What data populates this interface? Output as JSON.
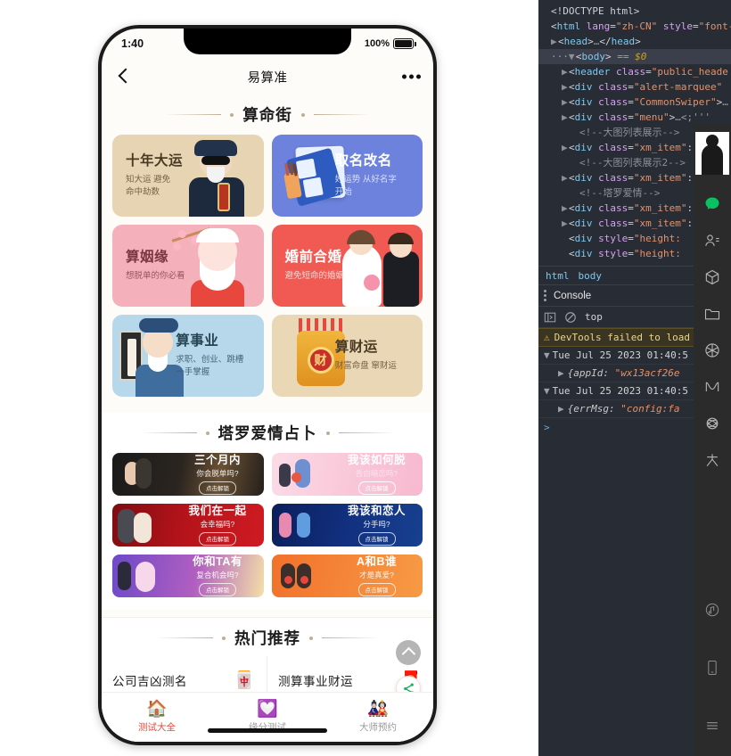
{
  "phone": {
    "status": {
      "time": "1:40",
      "battery_pct": "100%"
    },
    "nav": {
      "title": "易算准",
      "back_icon": "chevron-left-icon",
      "more_icon": "more-horizontal-icon"
    },
    "sections": [
      {
        "title": "算命街"
      },
      {
        "title": "塔罗爱情占卜"
      },
      {
        "title": "热门推荐"
      }
    ],
    "menu_cards": [
      {
        "title": "十年大运",
        "sub": "知大运 避免\n命中劫数",
        "art": "elder-icon",
        "color": "#e6d4b3"
      },
      {
        "title": "取名改名",
        "sub": "好运势 从好名字\n开始",
        "art": "naming-book-icon",
        "color": "#6c82dd"
      },
      {
        "title": "算姻缘",
        "sub": "想脱单的你必看",
        "art": "fuxing-icon",
        "color": "#f5b1bb"
      },
      {
        "title": "婚前合婚",
        "sub": "避免短命的婚姻",
        "art": "wedding-couple-icon",
        "color": "#f05a52"
      },
      {
        "title": "算事业",
        "sub": "求职、创业、跳槽\n一手掌握",
        "art": "scholar-icon",
        "color": "#b6d8ea"
      },
      {
        "title": "算财运",
        "sub": "财富命盘 窜财运",
        "art": "wealth-pot-icon",
        "color": "#e9d7b6"
      }
    ],
    "tarot_cards": [
      {
        "title": "三个月内",
        "sub": "你会脱单吗?",
        "btn": "点击解锁",
        "art": "couple-dark-icon"
      },
      {
        "title": "我该如何脱",
        "sub": "告白暗恋吗?",
        "btn": "点击解锁",
        "art": "couple-pink-icon"
      },
      {
        "title": "我们在一起",
        "sub": "会幸福吗?",
        "btn": "点击解锁",
        "art": "couple-red-icon"
      },
      {
        "title": "我该和恋人",
        "sub": "分手吗?",
        "btn": "点击解锁",
        "art": "couple-blue-icon"
      },
      {
        "title": "你和TA有",
        "sub": "复合机会吗?",
        "btn": "点击解锁",
        "art": "couple-purple-icon"
      },
      {
        "title": "A和B谁",
        "sub": "才是真爱?",
        "btn": "点击解锁",
        "art": "couple-orange-icon"
      }
    ],
    "hot_items": [
      {
        "label": "公司吉凶测名",
        "icon": "name-seal-icon"
      },
      {
        "label": "测算事业财运",
        "icon": "money-bag-icon"
      },
      {
        "label": "",
        "icon": "red-house-icon"
      },
      {
        "label": "",
        "icon": "heart-icon"
      }
    ],
    "fabs": [
      {
        "name": "scroll-to-top",
        "icon": "chevron-up-icon"
      },
      {
        "name": "share",
        "icon": "share-icon"
      }
    ],
    "tabs": [
      {
        "label": "测试大全",
        "icon": "home-icon",
        "active": true
      },
      {
        "label": "缘分测试",
        "icon": "heart-icon",
        "active": false
      },
      {
        "label": "大师预约",
        "icon": "masters-icon",
        "active": false
      }
    ]
  },
  "devtools": {
    "dom": [
      {
        "indent": 0,
        "twisty": "",
        "parts": [
          {
            "c": "punc",
            "t": "<!DOCTYPE html>"
          }
        ]
      },
      {
        "indent": 0,
        "twisty": "",
        "parts": [
          {
            "c": "punc",
            "t": "<"
          },
          {
            "c": "tag",
            "t": "html"
          },
          {
            "c": "attr",
            "t": " lang"
          },
          {
            "c": "eq",
            "t": "="
          },
          {
            "c": "val",
            "t": "\"zh-CN\""
          },
          {
            "c": "attr",
            "t": " style"
          },
          {
            "c": "eq",
            "t": "="
          },
          {
            "c": "val",
            "t": "\"font-"
          }
        ]
      },
      {
        "indent": 1,
        "twisty": "▶",
        "parts": [
          {
            "c": "punc",
            "t": "<"
          },
          {
            "c": "tag",
            "t": "head"
          },
          {
            "c": "punc",
            "t": ">"
          },
          {
            "c": "dots",
            "t": "…"
          },
          {
            "c": "punc",
            "t": "</"
          },
          {
            "c": "tag",
            "t": "head"
          },
          {
            "c": "punc",
            "t": ">"
          }
        ]
      },
      {
        "indent": 1,
        "twisty": "▼",
        "selected": true,
        "prefix": "···",
        "parts": [
          {
            "c": "punc",
            "t": "<"
          },
          {
            "c": "tag",
            "t": "body"
          },
          {
            "c": "punc",
            "t": ">"
          },
          {
            "c": "gray",
            "t": "  == "
          },
          {
            "c": "ital",
            "t": "$0"
          }
        ]
      },
      {
        "indent": 2,
        "twisty": "▶",
        "parts": [
          {
            "c": "punc",
            "t": "<"
          },
          {
            "c": "tag",
            "t": "header"
          },
          {
            "c": "attr",
            "t": " class"
          },
          {
            "c": "eq",
            "t": "="
          },
          {
            "c": "val",
            "t": "\"public_heade"
          }
        ]
      },
      {
        "indent": 2,
        "twisty": "▶",
        "parts": [
          {
            "c": "punc",
            "t": "<"
          },
          {
            "c": "tag",
            "t": "div"
          },
          {
            "c": "attr",
            "t": " class"
          },
          {
            "c": "eq",
            "t": "="
          },
          {
            "c": "val",
            "t": "\"alert-marquee\""
          }
        ]
      },
      {
        "indent": 2,
        "twisty": "▶",
        "parts": [
          {
            "c": "punc",
            "t": "<"
          },
          {
            "c": "tag",
            "t": "div"
          },
          {
            "c": "attr",
            "t": " class"
          },
          {
            "c": "eq",
            "t": "="
          },
          {
            "c": "val",
            "t": "\"CommonSwiper\""
          },
          {
            "c": "punc",
            "t": ">"
          },
          {
            "c": "dots",
            "t": "…"
          }
        ]
      },
      {
        "indent": 2,
        "twisty": "▶",
        "parts": [
          {
            "c": "punc",
            "t": "<"
          },
          {
            "c": "tag",
            "t": "div"
          },
          {
            "c": "attr",
            "t": " class"
          },
          {
            "c": "eq",
            "t": "="
          },
          {
            "c": "val",
            "t": "\"menu\""
          },
          {
            "c": "punc",
            "t": ">"
          },
          {
            "c": "dots",
            "t": "…<;'''"
          }
        ]
      },
      {
        "indent": 3,
        "twisty": "",
        "parts": [
          {
            "c": "cmt",
            "t": "<!--大图列表展示-->"
          }
        ]
      },
      {
        "indent": 2,
        "twisty": "▶",
        "parts": [
          {
            "c": "punc",
            "t": "<"
          },
          {
            "c": "tag",
            "t": "div"
          },
          {
            "c": "attr",
            "t": " class"
          },
          {
            "c": "eq",
            "t": "="
          },
          {
            "c": "val",
            "t": "\"xm_item\""
          },
          {
            "c": "punc",
            "t": ":"
          }
        ]
      },
      {
        "indent": 3,
        "twisty": "",
        "parts": [
          {
            "c": "cmt",
            "t": "<!--大图列表展示2-->"
          }
        ]
      },
      {
        "indent": 2,
        "twisty": "▶",
        "parts": [
          {
            "c": "punc",
            "t": "<"
          },
          {
            "c": "tag",
            "t": "div"
          },
          {
            "c": "attr",
            "t": " class"
          },
          {
            "c": "eq",
            "t": "="
          },
          {
            "c": "val",
            "t": "\"xm_item\""
          },
          {
            "c": "punc",
            "t": ":"
          }
        ]
      },
      {
        "indent": 3,
        "twisty": "",
        "parts": [
          {
            "c": "cmt",
            "t": "<!--塔罗爱情-->"
          }
        ]
      },
      {
        "indent": 2,
        "twisty": "▶",
        "parts": [
          {
            "c": "punc",
            "t": "<"
          },
          {
            "c": "tag",
            "t": "div"
          },
          {
            "c": "attr",
            "t": " class"
          },
          {
            "c": "eq",
            "t": "="
          },
          {
            "c": "val",
            "t": "\"xm_item\""
          },
          {
            "c": "punc",
            "t": ":"
          }
        ]
      },
      {
        "indent": 2,
        "twisty": "▶",
        "parts": [
          {
            "c": "punc",
            "t": "<"
          },
          {
            "c": "tag",
            "t": "div"
          },
          {
            "c": "attr",
            "t": " class"
          },
          {
            "c": "eq",
            "t": "="
          },
          {
            "c": "val",
            "t": "\"xm_item\""
          },
          {
            "c": "punc",
            "t": ":"
          }
        ]
      },
      {
        "indent": 2,
        "twisty": "",
        "parts": [
          {
            "c": "punc",
            "t": "<"
          },
          {
            "c": "tag",
            "t": "div"
          },
          {
            "c": "attr",
            "t": " style"
          },
          {
            "c": "eq",
            "t": "="
          },
          {
            "c": "val",
            "t": "\"height: "
          }
        ]
      },
      {
        "indent": 2,
        "twisty": "",
        "parts": [
          {
            "c": "punc",
            "t": "<"
          },
          {
            "c": "tag",
            "t": "div"
          },
          {
            "c": "attr",
            "t": " style"
          },
          {
            "c": "eq",
            "t": "="
          },
          {
            "c": "val",
            "t": "\"height: "
          }
        ]
      }
    ],
    "breadcrumb": [
      "html",
      "body"
    ],
    "console_tab_label": "Console",
    "context_selector": "top",
    "warning": "DevTools failed to load",
    "logs": [
      {
        "type": "group",
        "text": "Tue Jul 25 2023 01:40:5"
      },
      {
        "type": "object",
        "key": "{appId:",
        "value": "\"wx13acf26e"
      },
      {
        "type": "group",
        "text": "Tue Jul 25 2023 01:40:5"
      },
      {
        "type": "object",
        "key": "{errMsg:",
        "value": "\"config:fa"
      }
    ],
    "prompt": ">"
  },
  "wechat_rail": {
    "avatar": "user-avatar",
    "items": [
      {
        "icon": "chat-bubble-icon",
        "active": true
      },
      {
        "icon": "contacts-icon",
        "active": false
      },
      {
        "icon": "cube-icon",
        "active": false
      },
      {
        "icon": "folder-icon",
        "active": false
      },
      {
        "icon": "aperture-icon",
        "active": false
      },
      {
        "icon": "channels-icon",
        "active": false
      },
      {
        "icon": "atom-icon",
        "active": false
      },
      {
        "icon": "people-icon",
        "active": false
      }
    ],
    "bottom_items": [
      {
        "icon": "music-note-circle-icon"
      },
      {
        "icon": "phone-icon"
      },
      {
        "icon": "menu-icon"
      }
    ]
  }
}
